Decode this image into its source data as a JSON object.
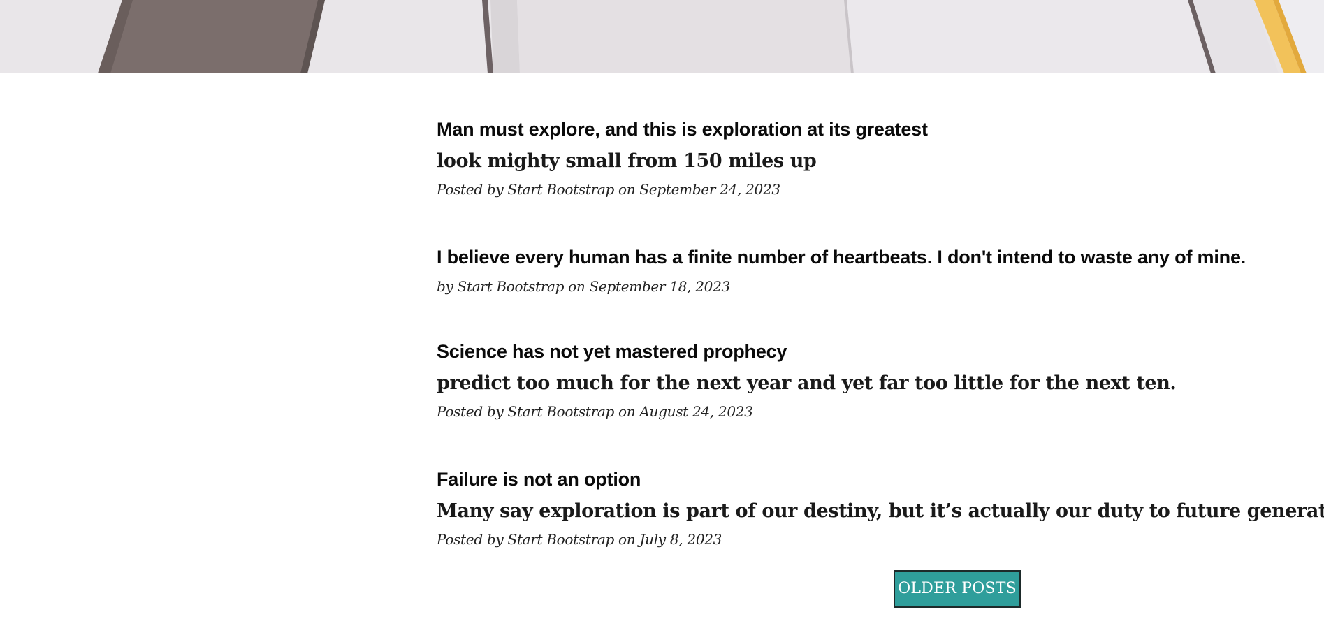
{
  "posts": [
    {
      "title": "Man must explore, and this is exploration at its greatest",
      "subtitle": "look mighty small from 150 miles up",
      "meta": "Posted by Start Bootstrap on September 24, 2023"
    },
    {
      "title": "I believe every human has a finite number of heartbeats. I don't intend to waste any of mine.",
      "subtitle": "",
      "meta": "by Start Bootstrap on September 18, 2023"
    },
    {
      "title": "Science has not yet mastered prophecy",
      "subtitle": "predict too much for the next year and yet far too little for the next ten.",
      "meta": "Posted by Start Bootstrap on August 24, 2023"
    },
    {
      "title": "Failure is not an option",
      "subtitle": "Many say exploration is part of our destiny, but it’s actually our duty to future generations.",
      "meta": "Posted by Start Bootstrap on July 8, 2023"
    }
  ],
  "pager": {
    "older_label": "OLDER POSTS"
  },
  "colors": {
    "button_bg": "#2f9e9b",
    "button_border": "#1d2a2a",
    "text": "#0a0a0a"
  }
}
